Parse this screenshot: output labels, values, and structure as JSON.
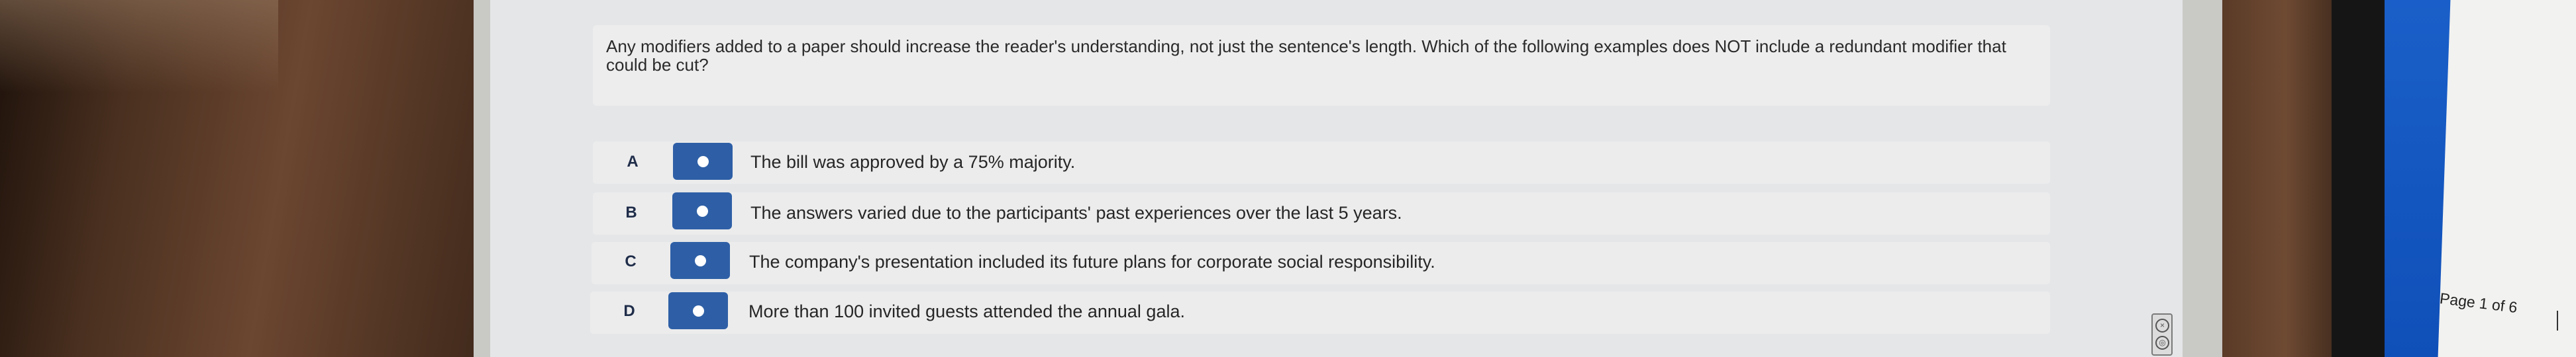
{
  "question": {
    "text": "Any modifiers added to a paper should increase the reader's understanding, not just the sentence's length. Which of the following examples does NOT include a redundant modifier that could be cut?"
  },
  "options": [
    {
      "letter": "A",
      "text": "The bill was approved by a 75% majority."
    },
    {
      "letter": "B",
      "text": "The answers varied due to the participants' past experiences over the last 5 years."
    },
    {
      "letter": "C",
      "text": "The company's presentation included its future plans for corporate social responsibility."
    },
    {
      "letter": "D",
      "text": "More than 100 invited guests attended the annual gala."
    }
  ],
  "second_screen": {
    "page_indicator": "Page 1 of 6"
  },
  "icons": {
    "option_button": "radio-dot-icon",
    "side_widget": [
      "close-icon",
      "settings-icon"
    ]
  },
  "colors": {
    "accent": "#2e5fa6",
    "panel": "#ececed"
  }
}
